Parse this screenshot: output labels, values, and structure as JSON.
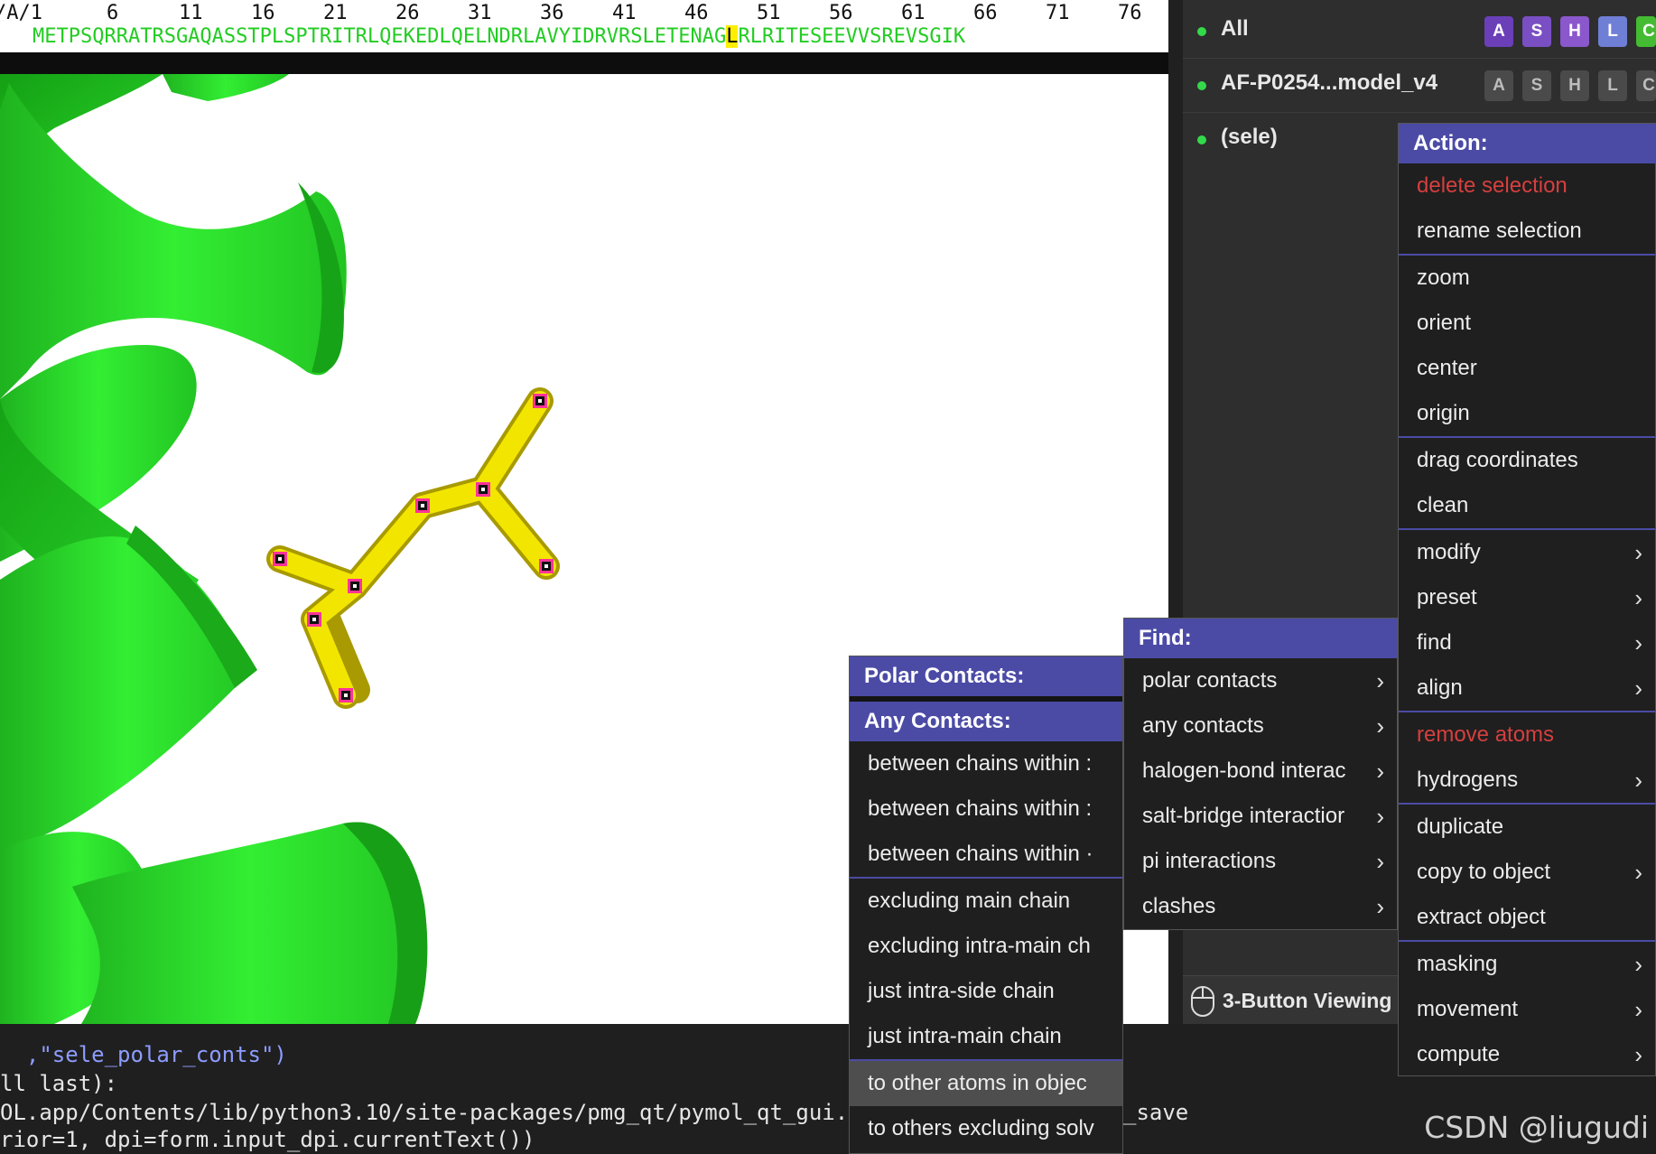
{
  "sequence": {
    "chain_label": "/A/1",
    "ruler_numbers": [
      "6",
      "11",
      "16",
      "21",
      "26",
      "31",
      "36",
      "41",
      "46",
      "51",
      "56",
      "61",
      "66",
      "71",
      "76"
    ],
    "residues_before": "METPSQRRATRSGAQASSTPLSPTRITRLQEKEDLQELNDRLAVYIDRVRSLETENAG",
    "highlighted_residue": "L",
    "residues_after": "RLRITESEEVVSREVSGIK"
  },
  "objects": [
    {
      "name": "All",
      "buttons": [
        "A",
        "S",
        "H",
        "L",
        "C"
      ],
      "style": "colored"
    },
    {
      "name": "AF-P0254...model_v4",
      "buttons": [
        "A",
        "S",
        "H",
        "L",
        "C"
      ],
      "style": "gray"
    },
    {
      "name": "(sele)",
      "buttons": [],
      "style": "none"
    }
  ],
  "button_colors": {
    "A": "#6a3fb8",
    "S": "#7a4fc4",
    "H": "#8a58cc",
    "L": "#6f7fd6",
    "C": "#44bb33"
  },
  "mouse_mode": "3-Button Viewing",
  "action_menu": {
    "title": "Action:",
    "groups": [
      [
        {
          "label": "delete selection",
          "red": true
        },
        {
          "label": "rename selection"
        }
      ],
      [
        {
          "label": "zoom"
        },
        {
          "label": "orient"
        },
        {
          "label": "center"
        },
        {
          "label": "origin"
        }
      ],
      [
        {
          "label": "drag coordinates"
        },
        {
          "label": "clean"
        }
      ],
      [
        {
          "label": "modify",
          "sub": true
        },
        {
          "label": "preset",
          "sub": true
        },
        {
          "label": "find",
          "sub": true
        },
        {
          "label": "align",
          "sub": true
        }
      ],
      [
        {
          "label": "remove atoms",
          "red": true
        },
        {
          "label": "hydrogens",
          "sub": true
        }
      ],
      [
        {
          "label": "duplicate"
        },
        {
          "label": "copy to object",
          "sub": true
        },
        {
          "label": "extract object"
        }
      ],
      [
        {
          "label": "masking",
          "sub": true
        },
        {
          "label": "movement",
          "sub": true
        },
        {
          "label": "compute",
          "sub": true
        }
      ]
    ]
  },
  "find_menu": {
    "title": "Find:",
    "items": [
      {
        "label": "polar contacts",
        "sub": true
      },
      {
        "label": "any contacts",
        "sub": true
      },
      {
        "label": "halogen-bond interac",
        "sub": true
      },
      {
        "label": "salt-bridge interactior",
        "sub": true
      },
      {
        "label": "pi interactions",
        "sub": true
      },
      {
        "label": "clashes",
        "sub": true
      }
    ]
  },
  "polar_menu": {
    "title": "Polar Contacts:",
    "subtitle": "Any Contacts:",
    "group1": [
      "between chains within :",
      "between chains within :",
      "between chains within ·"
    ],
    "group2": [
      "excluding main chain",
      "excluding intra-main ch",
      "just intra-side chain",
      "just intra-main chain"
    ],
    "group3": [
      "to other atoms in objec",
      "to others excluding solv"
    ],
    "hovered_item": "to other atoms in objec"
  },
  "console": {
    "lines": [
      "  ,\"sele_polar_conts\")",
      "ll last):",
      "OL.app/Contents/lib/python3.10/site-packages/pmg_qt/pymol_qt_gui.p",
      "rior=1, dpi=form.input_dpi.currentText())"
    ],
    "trailing_fragment": "_save"
  },
  "watermark": "CSDN @liugudi",
  "colors": {
    "cartoon": "#33dd33",
    "sticks": "#e6d800",
    "selection_marker": "#ff3399",
    "menu_header": "#4b4ba6"
  }
}
